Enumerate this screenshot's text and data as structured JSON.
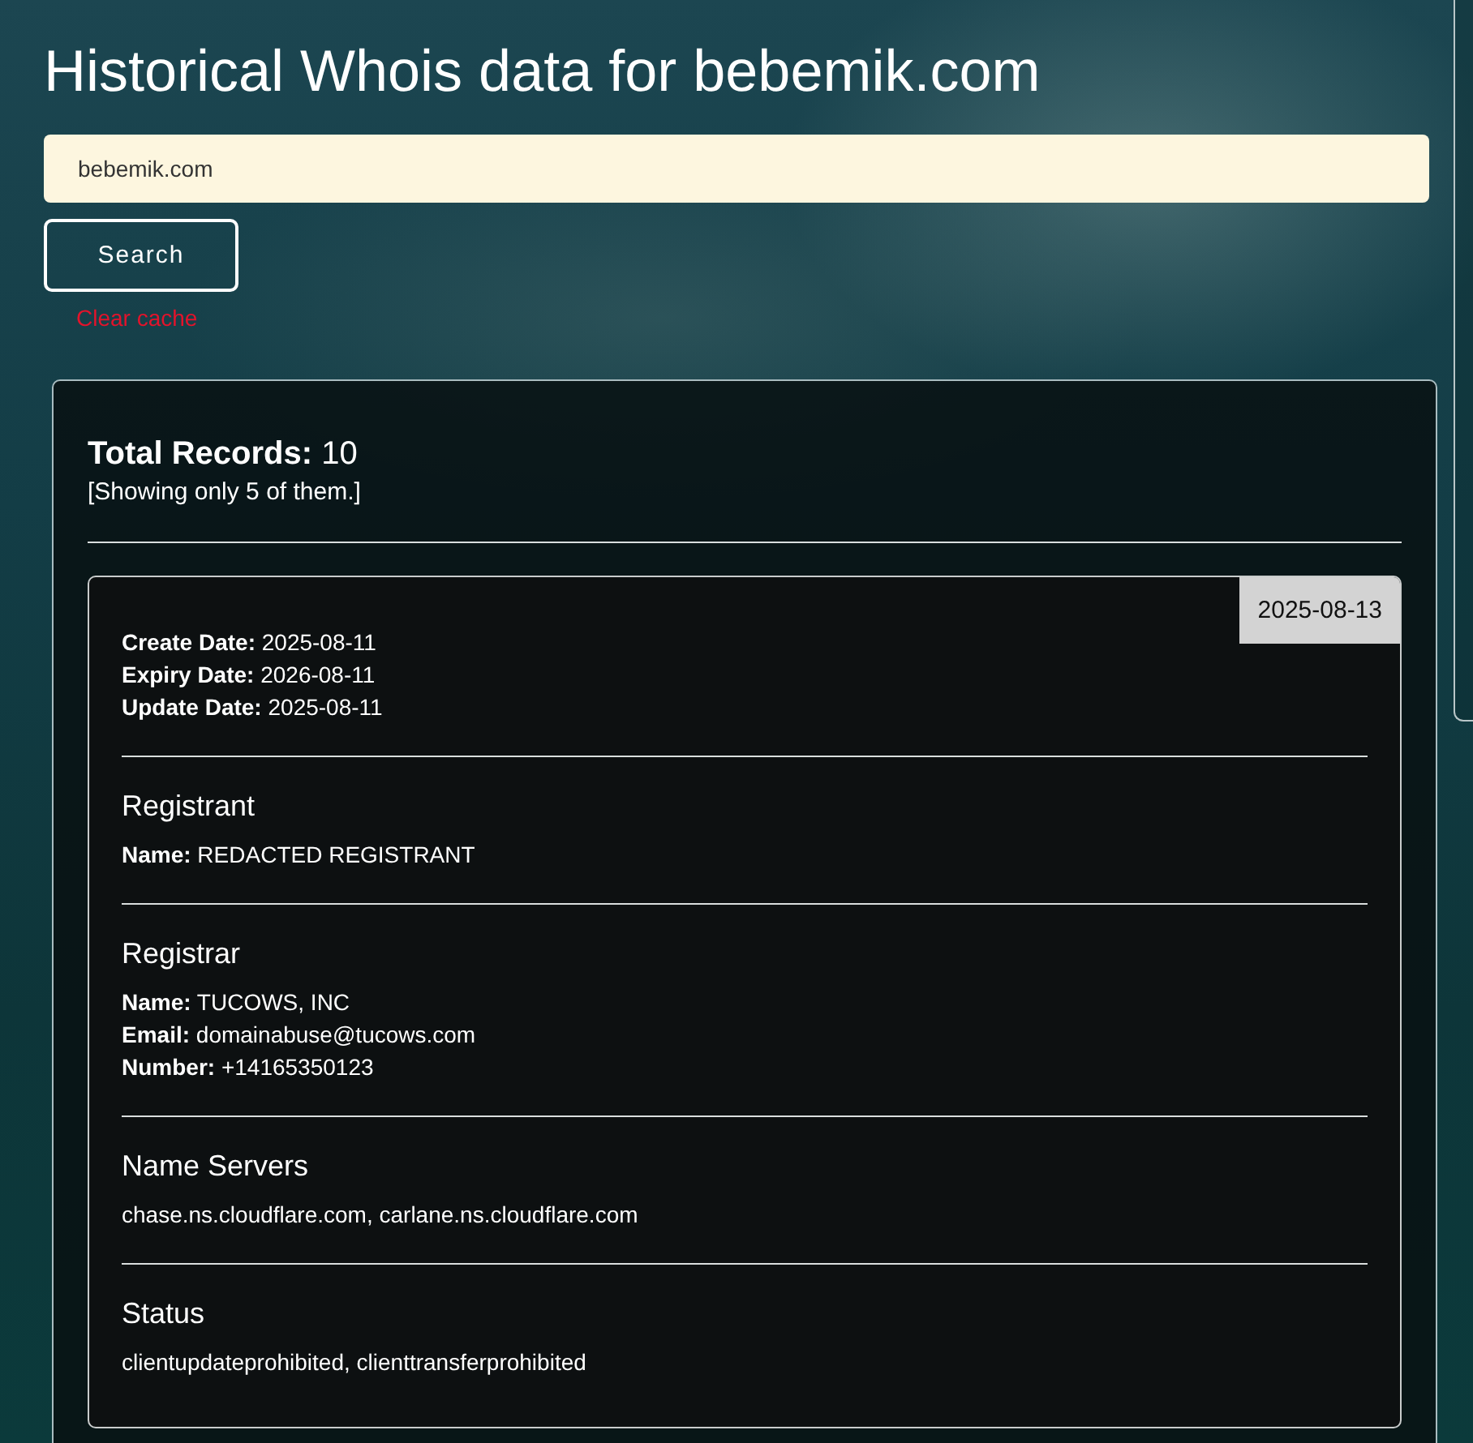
{
  "title": "Historical Whois data for bebemik.com",
  "search": {
    "value": "bebemik.com",
    "button": "Search",
    "clear_link": "Clear cache"
  },
  "results": {
    "total": "**Total Records:** 10",
    "note": "[Showing only 5 of them.]",
    "records": [
      {
        "date": "2025-08-13",
        "dates": [
          "**Create Date:** 2025-08-11",
          "**Expiry Date:** 2026-08-11",
          "**Update Date:** 2025-08-11"
        ],
        "sections": [
          {
            "heading": "Registrant",
            "lines": [
              "**Name:** REDACTED REGISTRANT"
            ]
          },
          {
            "heading": "Registrar",
            "lines": [
              "**Name:** TUCOWS, INC",
              "**Email:** domainabuse@tucows.com",
              "**Number:** +14165350123"
            ]
          },
          {
            "heading": "Name Servers",
            "lines": [
              "chase.ns.cloudflare.com, carlane.ns.cloudflare.com"
            ]
          },
          {
            "heading": "Status",
            "lines": [
              "clientupdateprohibited, clienttransferprohibited"
            ]
          }
        ]
      }
    ]
  }
}
